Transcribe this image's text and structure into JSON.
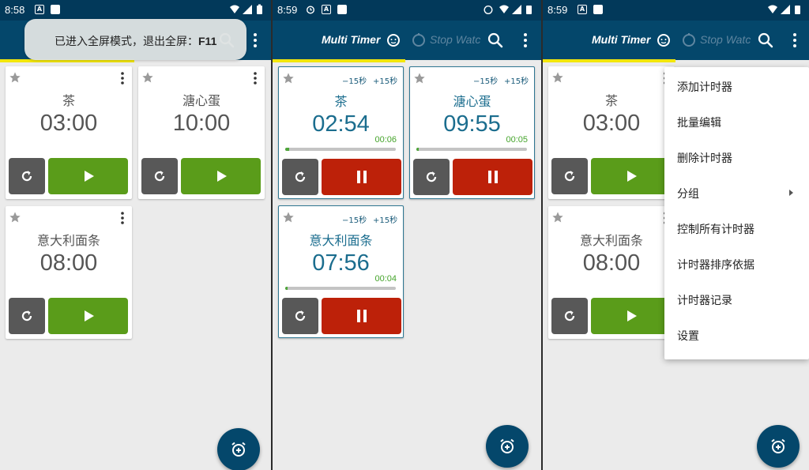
{
  "colors": {
    "appbar": "#04476b",
    "statusbar": "#02395a",
    "indicator": "#f2e60a",
    "play": "#5a9c1a",
    "pause": "#bd2109",
    "reset": "#585858",
    "running_text": "#1b6d8e",
    "elapsed_text": "#45a42b"
  },
  "app": {
    "tab_active": "Multi Timer",
    "tab_inactive": "Stop Watc"
  },
  "panel1": {
    "status_time": "8:58",
    "toast_prefix": "已进入全屏模式，退出全屏：",
    "toast_key": "F11",
    "cards": [
      {
        "name": "茶",
        "time": "03:00",
        "state": "stopped"
      },
      {
        "name": "溏心蛋",
        "time": "10:00",
        "state": "stopped"
      },
      {
        "name": "意大利面条",
        "time": "08:00",
        "state": "stopped"
      }
    ]
  },
  "panel2": {
    "status_time": "8:59",
    "cards": [
      {
        "name": "茶",
        "time": "02:54",
        "elapsed": "00:06",
        "progress": 0.033,
        "minus": "−15秒",
        "plus": "+15秒",
        "state": "running"
      },
      {
        "name": "溏心蛋",
        "time": "09:55",
        "elapsed": "00:05",
        "progress": 0.008,
        "minus": "−15秒",
        "plus": "+15秒",
        "state": "running"
      },
      {
        "name": "意大利面条",
        "time": "07:56",
        "elapsed": "00:04",
        "progress": 0.008,
        "minus": "−15秒",
        "plus": "+15秒",
        "state": "running"
      }
    ]
  },
  "panel3": {
    "status_time": "8:59",
    "cards": [
      {
        "name": "茶",
        "time": "03:00",
        "state": "stopped"
      },
      {
        "name": "意大利面条",
        "time": "08:00",
        "state": "stopped"
      }
    ],
    "menu": [
      {
        "label": "添加计时器"
      },
      {
        "label": "批量编辑"
      },
      {
        "label": "删除计时器"
      },
      {
        "label": "分组",
        "submenu": true
      },
      {
        "label": "控制所有计时器"
      },
      {
        "label": "计时器排序依据"
      },
      {
        "label": "计时器记录"
      },
      {
        "label": "设置"
      }
    ]
  }
}
